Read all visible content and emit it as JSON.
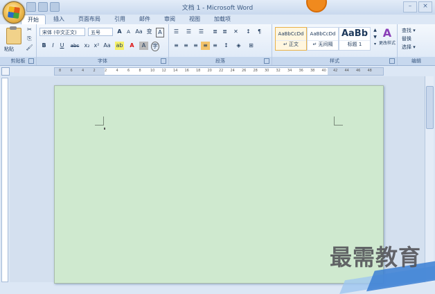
{
  "window": {
    "title": "文档 1 - Microsoft Word"
  },
  "tabs": [
    "开始",
    "插入",
    "页面布局",
    "引用",
    "邮件",
    "审阅",
    "视图",
    "加载项"
  ],
  "clipboard": {
    "paste": "粘贴",
    "label": "剪贴板"
  },
  "font": {
    "font_name": "宋体 (中文正文)",
    "font_size": "五号",
    "label": "字体",
    "row1": [
      "A",
      "A",
      "Aa",
      "变",
      "A"
    ],
    "row2": [
      "B",
      "I",
      "U",
      "abc",
      "x₂",
      "x²",
      "Aa",
      "ab",
      "A",
      "A",
      "字"
    ]
  },
  "paragraph": {
    "label": "段落",
    "row1": [
      "☰",
      "☰",
      "☰",
      "≣",
      "≣",
      "✕",
      "↕",
      "¶"
    ],
    "row2": [
      "≡",
      "≡",
      "≡",
      "≡",
      "≡",
      "↕",
      "◈",
      "⊞"
    ]
  },
  "styles": {
    "label": "样式",
    "items": [
      {
        "sample": "AaBbCcDd",
        "name": "↵ 正文"
      },
      {
        "sample": "AaBbCcDd",
        "name": "↵ 无间隔"
      },
      {
        "sample": "AaBb",
        "name": "标题 1"
      }
    ],
    "change": "更改样式"
  },
  "editing": {
    "label": "编辑",
    "find": "查找 ▾",
    "replace": "替换",
    "select": "选择 ▾"
  },
  "ruler": {
    "ticks": [
      "8",
      "6",
      "4",
      "2",
      "2",
      "4",
      "6",
      "8",
      "10",
      "12",
      "14",
      "16",
      "18",
      "20",
      "22",
      "24",
      "26",
      "28",
      "30",
      "32",
      "34",
      "36",
      "38",
      "40",
      "42",
      "44",
      "46",
      "48"
    ]
  },
  "watermark": "最需教育"
}
